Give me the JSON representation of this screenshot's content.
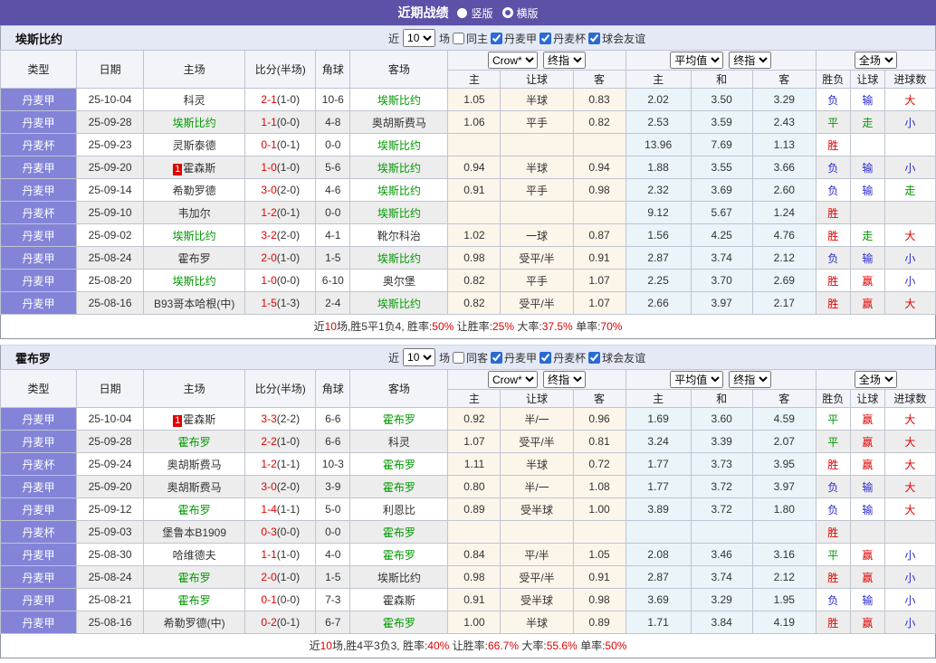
{
  "title_bar": {
    "title": "近期战绩",
    "radio_vertical": "竖版",
    "radio_horizontal": "横版"
  },
  "colors": {
    "title_bar_bg": "#5b51a6",
    "league_cell_bg": "#8384d8",
    "focus_team_green": "#009900",
    "score_red": "#e00000",
    "loss_blue": "#2b2bcc",
    "win_red": "#e00000",
    "draw_green": "#009900",
    "odds_col_bg": "#fcf5ea",
    "avg_col_bg": "#eaf4f9",
    "checkbox_blue": "#2a6ad4"
  },
  "sections": [
    {
      "team": "埃斯比约",
      "controls": {
        "near_label": "近",
        "count": "10",
        "field_label": "场",
        "same_label": "同主",
        "leagues": [
          "丹麦甲",
          "丹麦杯",
          "球会友谊"
        ]
      },
      "header": {
        "cols": [
          "类型",
          "日期",
          "主场",
          "比分(半场)",
          "角球",
          "客场"
        ],
        "odds_company": "Crow*",
        "odds_final": "终指",
        "avg_label": "平均值",
        "avg_final": "终指",
        "scope": "全场",
        "sub_cols": [
          "主",
          "让球",
          "客",
          "主",
          "和",
          "客",
          "胜负",
          "让球",
          "进球数"
        ]
      },
      "rows": [
        {
          "league": "丹麦甲",
          "date": "25-10-04",
          "home": "科灵",
          "home_badge": "",
          "home_green": false,
          "score": "2-1",
          "half": "(1-0)",
          "corners": "10-6",
          "away": "埃斯比约",
          "away_green": true,
          "odds": [
            "1.05",
            "半球",
            "0.83"
          ],
          "avg": [
            "2.02",
            "3.50",
            "3.29"
          ],
          "results": [
            "负",
            "输",
            "大"
          ]
        },
        {
          "league": "丹麦甲",
          "date": "25-09-28",
          "home": "埃斯比约",
          "home_badge": "",
          "home_green": true,
          "score": "1-1",
          "half": "(0-0)",
          "corners": "4-8",
          "away": "奥胡斯费马",
          "away_green": false,
          "odds": [
            "1.06",
            "平手",
            "0.82"
          ],
          "avg": [
            "2.53",
            "3.59",
            "2.43"
          ],
          "results": [
            "平",
            "走",
            "小"
          ]
        },
        {
          "league": "丹麦杯",
          "date": "25-09-23",
          "home": "灵斯泰德",
          "home_badge": "",
          "home_green": false,
          "score": "0-1",
          "half": "(0-1)",
          "corners": "0-0",
          "away": "埃斯比约",
          "away_green": true,
          "odds": [
            "",
            "",
            ""
          ],
          "avg": [
            "13.96",
            "7.69",
            "1.13"
          ],
          "results": [
            "胜",
            "",
            ""
          ]
        },
        {
          "league": "丹麦甲",
          "date": "25-09-20",
          "home": "霍森斯",
          "home_badge": "1",
          "home_green": false,
          "score": "1-0",
          "half": "(1-0)",
          "corners": "5-6",
          "away": "埃斯比约",
          "away_green": true,
          "odds": [
            "0.94",
            "半球",
            "0.94"
          ],
          "avg": [
            "1.88",
            "3.55",
            "3.66"
          ],
          "results": [
            "负",
            "输",
            "小"
          ]
        },
        {
          "league": "丹麦甲",
          "date": "25-09-14",
          "home": "希勒罗德",
          "home_badge": "",
          "home_green": false,
          "score": "3-0",
          "half": "(2-0)",
          "corners": "4-6",
          "away": "埃斯比约",
          "away_green": true,
          "odds": [
            "0.91",
            "平手",
            "0.98"
          ],
          "avg": [
            "2.32",
            "3.69",
            "2.60"
          ],
          "results": [
            "负",
            "输",
            "走"
          ]
        },
        {
          "league": "丹麦杯",
          "date": "25-09-10",
          "home": "韦加尔",
          "home_badge": "",
          "home_green": false,
          "score": "1-2",
          "half": "(0-1)",
          "corners": "0-0",
          "away": "埃斯比约",
          "away_green": true,
          "odds": [
            "",
            "",
            ""
          ],
          "avg": [
            "9.12",
            "5.67",
            "1.24"
          ],
          "results": [
            "胜",
            "",
            ""
          ]
        },
        {
          "league": "丹麦甲",
          "date": "25-09-02",
          "home": "埃斯比约",
          "home_badge": "",
          "home_green": true,
          "score": "3-2",
          "half": "(2-0)",
          "corners": "4-1",
          "away": "靴尔科治",
          "away_green": false,
          "odds": [
            "1.02",
            "一球",
            "0.87"
          ],
          "avg": [
            "1.56",
            "4.25",
            "4.76"
          ],
          "results": [
            "胜",
            "走",
            "大"
          ]
        },
        {
          "league": "丹麦甲",
          "date": "25-08-24",
          "home": "霍布罗",
          "home_badge": "",
          "home_green": false,
          "score": "2-0",
          "half": "(1-0)",
          "corners": "1-5",
          "away": "埃斯比约",
          "away_green": true,
          "odds": [
            "0.98",
            "受平/半",
            "0.91"
          ],
          "avg": [
            "2.87",
            "3.74",
            "2.12"
          ],
          "results": [
            "负",
            "输",
            "小"
          ]
        },
        {
          "league": "丹麦甲",
          "date": "25-08-20",
          "home": "埃斯比约",
          "home_badge": "",
          "home_green": true,
          "score": "1-0",
          "half": "(0-0)",
          "corners": "6-10",
          "away": "奥尔堡",
          "away_green": false,
          "odds": [
            "0.82",
            "平手",
            "1.07"
          ],
          "avg": [
            "2.25",
            "3.70",
            "2.69"
          ],
          "results": [
            "胜",
            "赢",
            "小"
          ]
        },
        {
          "league": "丹麦甲",
          "date": "25-08-16",
          "home": "B93哥本哈根(中)",
          "home_badge": "",
          "home_green": false,
          "score": "1-5",
          "half": "(1-3)",
          "corners": "2-4",
          "away": "埃斯比约",
          "away_green": true,
          "odds": [
            "0.82",
            "受平/半",
            "1.07"
          ],
          "avg": [
            "2.66",
            "3.97",
            "2.17"
          ],
          "results": [
            "胜",
            "赢",
            "大"
          ]
        }
      ],
      "summary": [
        {
          "text": "近"
        },
        {
          "text": "10",
          "red": true
        },
        {
          "text": "场,胜5平1负4, 胜率:"
        },
        {
          "text": "50%",
          "red": true
        },
        {
          "text": " 让胜率:"
        },
        {
          "text": "25%",
          "red": true
        },
        {
          "text": " 大率:"
        },
        {
          "text": "37.5%",
          "red": true
        },
        {
          "text": " 单率:"
        },
        {
          "text": "70%",
          "red": true
        }
      ]
    },
    {
      "team": "霍布罗",
      "controls": {
        "near_label": "近",
        "count": "10",
        "field_label": "场",
        "same_label": "同客",
        "leagues": [
          "丹麦甲",
          "丹麦杯",
          "球会友谊"
        ]
      },
      "header": {
        "cols": [
          "类型",
          "日期",
          "主场",
          "比分(半场)",
          "角球",
          "客场"
        ],
        "odds_company": "Crow*",
        "odds_final": "终指",
        "avg_label": "平均值",
        "avg_final": "终指",
        "scope": "全场",
        "sub_cols": [
          "主",
          "让球",
          "客",
          "主",
          "和",
          "客",
          "胜负",
          "让球",
          "进球数"
        ]
      },
      "rows": [
        {
          "league": "丹麦甲",
          "date": "25-10-04",
          "home": "霍森斯",
          "home_badge": "1",
          "home_green": false,
          "score": "3-3",
          "half": "(2-2)",
          "corners": "6-6",
          "away": "霍布罗",
          "away_green": true,
          "odds": [
            "0.92",
            "半/一",
            "0.96"
          ],
          "avg": [
            "1.69",
            "3.60",
            "4.59"
          ],
          "results": [
            "平",
            "赢",
            "大"
          ]
        },
        {
          "league": "丹麦甲",
          "date": "25-09-28",
          "home": "霍布罗",
          "home_badge": "",
          "home_green": true,
          "score": "2-2",
          "half": "(1-0)",
          "corners": "6-6",
          "away": "科灵",
          "away_green": false,
          "odds": [
            "1.07",
            "受平/半",
            "0.81"
          ],
          "avg": [
            "3.24",
            "3.39",
            "2.07"
          ],
          "results": [
            "平",
            "赢",
            "大"
          ]
        },
        {
          "league": "丹麦杯",
          "date": "25-09-24",
          "home": "奥胡斯费马",
          "home_badge": "",
          "home_green": false,
          "score": "1-2",
          "half": "(1-1)",
          "corners": "10-3",
          "away": "霍布罗",
          "away_green": true,
          "odds": [
            "1.11",
            "半球",
            "0.72"
          ],
          "avg": [
            "1.77",
            "3.73",
            "3.95"
          ],
          "results": [
            "胜",
            "赢",
            "大"
          ]
        },
        {
          "league": "丹麦甲",
          "date": "25-09-20",
          "home": "奥胡斯费马",
          "home_badge": "",
          "home_green": false,
          "score": "3-0",
          "half": "(2-0)",
          "corners": "3-9",
          "away": "霍布罗",
          "away_green": true,
          "odds": [
            "0.80",
            "半/一",
            "1.08"
          ],
          "avg": [
            "1.77",
            "3.72",
            "3.97"
          ],
          "results": [
            "负",
            "输",
            "大"
          ]
        },
        {
          "league": "丹麦甲",
          "date": "25-09-12",
          "home": "霍布罗",
          "home_badge": "",
          "home_green": true,
          "score": "1-4",
          "half": "(1-1)",
          "corners": "5-0",
          "away": "利恩比",
          "away_green": false,
          "odds": [
            "0.89",
            "受半球",
            "1.00"
          ],
          "avg": [
            "3.89",
            "3.72",
            "1.80"
          ],
          "results": [
            "负",
            "输",
            "大"
          ]
        },
        {
          "league": "丹麦杯",
          "date": "25-09-03",
          "home": "堡鲁本B1909",
          "home_badge": "",
          "home_green": false,
          "score": "0-3",
          "half": "(0-0)",
          "corners": "0-0",
          "away": "霍布罗",
          "away_green": true,
          "odds": [
            "",
            "",
            ""
          ],
          "avg": [
            "",
            "",
            ""
          ],
          "results": [
            "胜",
            "",
            ""
          ]
        },
        {
          "league": "丹麦甲",
          "date": "25-08-30",
          "home": "哈维德夫",
          "home_badge": "",
          "home_green": false,
          "score": "1-1",
          "half": "(1-0)",
          "corners": "4-0",
          "away": "霍布罗",
          "away_green": true,
          "odds": [
            "0.84",
            "平/半",
            "1.05"
          ],
          "avg": [
            "2.08",
            "3.46",
            "3.16"
          ],
          "results": [
            "平",
            "赢",
            "小"
          ]
        },
        {
          "league": "丹麦甲",
          "date": "25-08-24",
          "home": "霍布罗",
          "home_badge": "",
          "home_green": true,
          "score": "2-0",
          "half": "(1-0)",
          "corners": "1-5",
          "away": "埃斯比约",
          "away_green": false,
          "odds": [
            "0.98",
            "受平/半",
            "0.91"
          ],
          "avg": [
            "2.87",
            "3.74",
            "2.12"
          ],
          "results": [
            "胜",
            "赢",
            "小"
          ]
        },
        {
          "league": "丹麦甲",
          "date": "25-08-21",
          "home": "霍布罗",
          "home_badge": "",
          "home_green": true,
          "score": "0-1",
          "half": "(0-0)",
          "corners": "7-3",
          "away": "霍森斯",
          "away_green": false,
          "odds": [
            "0.91",
            "受半球",
            "0.98"
          ],
          "avg": [
            "3.69",
            "3.29",
            "1.95"
          ],
          "results": [
            "负",
            "输",
            "小"
          ]
        },
        {
          "league": "丹麦甲",
          "date": "25-08-16",
          "home": "希勒罗德(中)",
          "home_badge": "",
          "home_green": false,
          "score": "0-2",
          "half": "(0-1)",
          "corners": "6-7",
          "away": "霍布罗",
          "away_green": true,
          "odds": [
            "1.00",
            "半球",
            "0.89"
          ],
          "avg": [
            "1.71",
            "3.84",
            "4.19"
          ],
          "results": [
            "胜",
            "赢",
            "小"
          ]
        }
      ],
      "summary": [
        {
          "text": "近"
        },
        {
          "text": "10",
          "red": true
        },
        {
          "text": "场,胜4平3负3, 胜率:"
        },
        {
          "text": "40%",
          "red": true
        },
        {
          "text": " 让胜率:"
        },
        {
          "text": "66.7%",
          "red": true
        },
        {
          "text": " 大率:"
        },
        {
          "text": "55.6%",
          "red": true
        },
        {
          "text": " 单率:"
        },
        {
          "text": "50%",
          "red": true
        }
      ]
    }
  ]
}
